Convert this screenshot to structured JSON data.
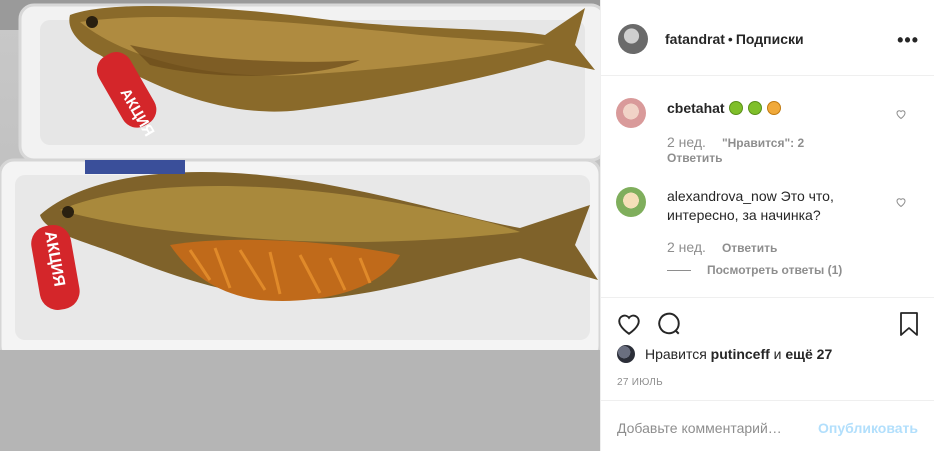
{
  "header": {
    "username": "fatandrat",
    "separator": "•",
    "follow": "Подписки",
    "more": "•••"
  },
  "photo": {
    "tag_text": "АКЦИЯ"
  },
  "comments": [
    {
      "username": "cbetahat",
      "text": "",
      "time": "2 нед.",
      "likes": "\"Нравится\": 2",
      "reply": "Ответить"
    },
    {
      "username": "alexandrova_now",
      "text": "Это что, интересно, за начинка?",
      "time": "2 нед.",
      "reply": "Ответить",
      "replies": "Посмотреть ответы (1)"
    }
  ],
  "actions": {
    "liked_by_prefix": "Нравится",
    "liked_by_user": "putinceff",
    "liked_by_mid": "и",
    "liked_by_rest": "ещё 27"
  },
  "date": "27 ИЮЛЬ",
  "comment_box": {
    "placeholder": "Добавьте комментарий…",
    "publish": "Опубликовать"
  },
  "icons": {
    "like": "heart-icon",
    "comment": "comment-icon",
    "save": "bookmark-icon"
  }
}
